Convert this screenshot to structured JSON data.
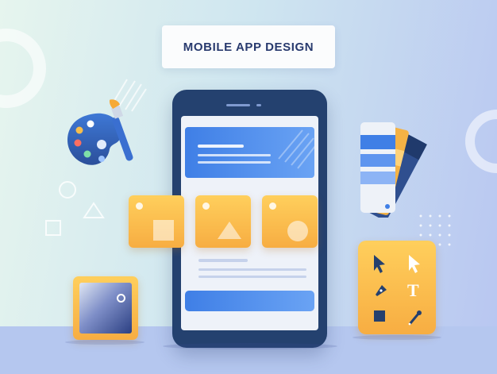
{
  "banner": {
    "title": "MOBILE APP DESIGN"
  },
  "illustration": {
    "icons": [
      "palette-icon",
      "paintbrush-icon",
      "color-swatch-fan-icon",
      "color-picker-icon",
      "design-tools-panel-icon",
      "smartphone-icon"
    ],
    "tools": [
      "arrow-cursor-icon",
      "pointer-cursor-icon",
      "pen-tool-icon",
      "text-tool-icon",
      "square-tool-icon",
      "eyedropper-icon"
    ],
    "colors": {
      "phone_frame": "#24416f",
      "accent_blue": "#3f7fe6",
      "accent_orange": "#f7ad42",
      "title_text": "#283a6e"
    }
  }
}
